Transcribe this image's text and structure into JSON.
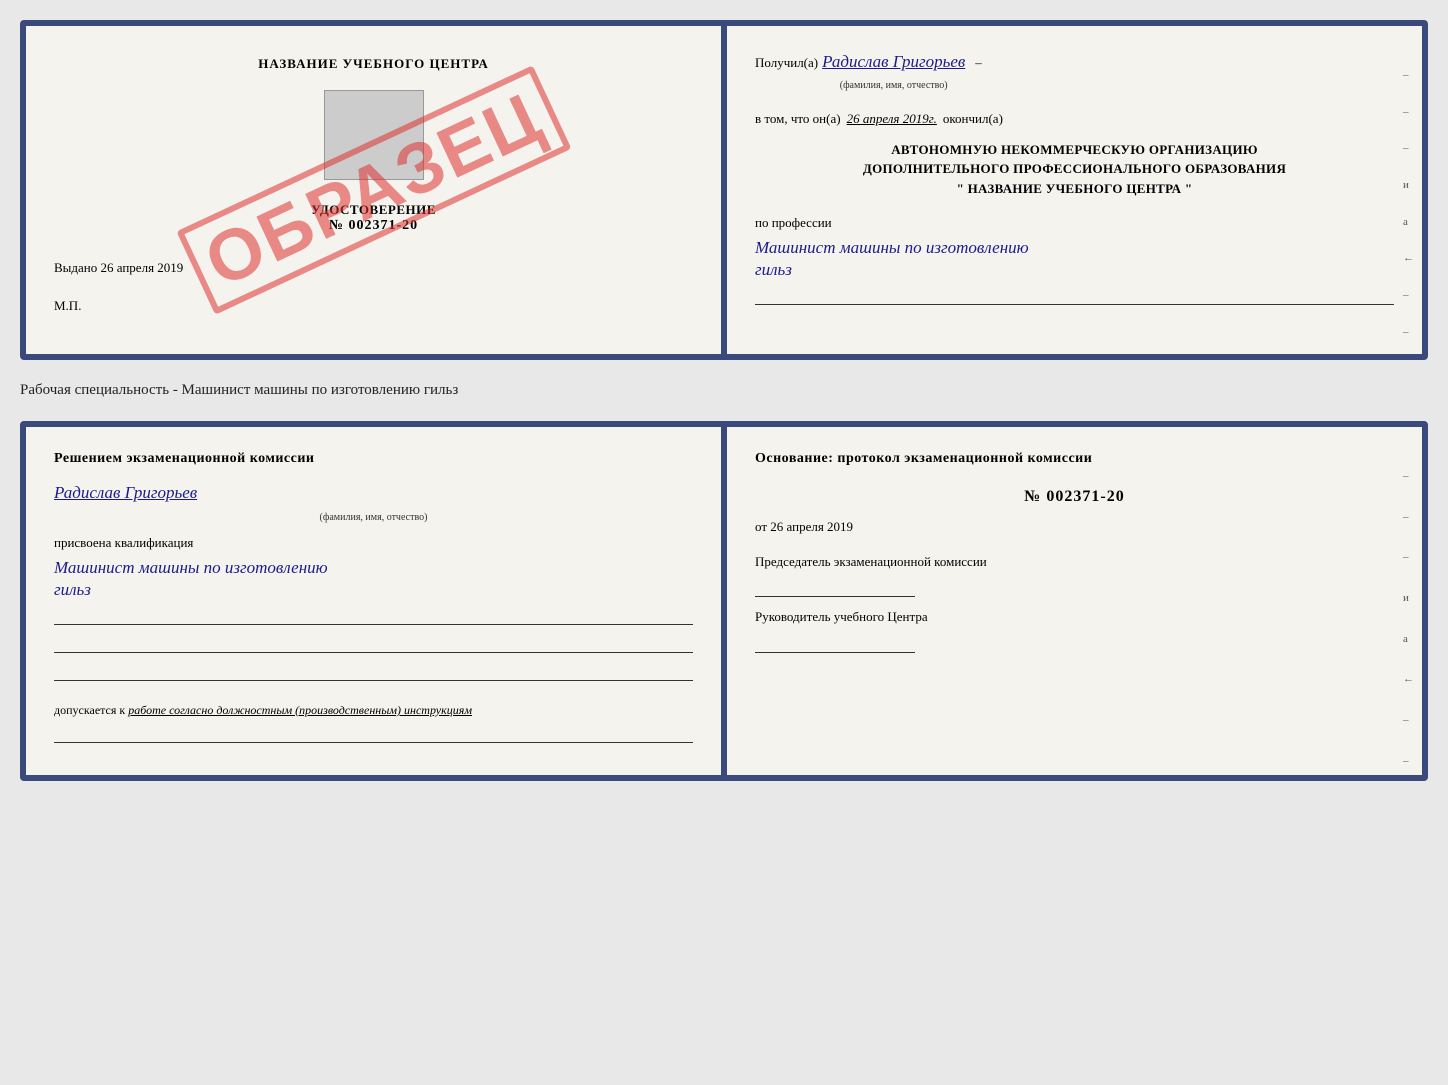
{
  "top_card": {
    "left": {
      "title": "НАЗВАНИЕ УЧЕБНОГО ЦЕНТРА",
      "udostoverenie_label": "УДОСТОВЕРЕНИЕ",
      "number": "№ 002371-20",
      "vydano_label": "Выдано",
      "vydano_date": "26 апреля 2019",
      "mp": "М.П.",
      "stamp": "ОБРАЗЕЦ"
    },
    "right": {
      "poluchil_label": "Получил(а)",
      "poluchil_name": "Радислав Григорьев",
      "fio_subtitle": "(фамилия, имя, отчество)",
      "vtom_label": "в том, что он(а)",
      "vtom_date": "26 апреля 2019г.",
      "okonchil_label": "окончил(а)",
      "org_line1": "АВТОНОМНУЮ НЕКОММЕРЧЕСКУЮ ОРГАНИЗАЦИЮ",
      "org_line2": "ДОПОЛНИТЕЛЬНОГО ПРОФЕССИОНАЛЬНОГО ОБРАЗОВАНИЯ",
      "org_line3": "\"   НАЗВАНИЕ УЧЕБНОГО ЦЕНТРА   \"",
      "po_professii_label": "по профессии",
      "profession_line1": "Машинист машины по изготовлению",
      "profession_line2": "гильз",
      "dashes": [
        "-",
        "-",
        "-",
        "и",
        "а",
        "←",
        "-",
        "-",
        "-"
      ]
    }
  },
  "specialty_label": "Рабочая специальность - Машинист машины по изготовлению гильз",
  "bottom_card": {
    "left": {
      "komissia_title": "Решением экзаменационной комиссии",
      "name": "Радислав Григорьев",
      "fio_subtitle": "(фамилия, имя, отчество)",
      "prisvoena_label": "присвоена квалификация",
      "kvali_line1": "Машинист машины по изготовлению",
      "kvali_line2": "гильз",
      "dopuskaetsya_prefix": "допускается к",
      "dopuskaetsya_text": "работе согласно должностным (производственным) инструкциям"
    },
    "right": {
      "osnovanie_title": "Основание: протокол экзаменационной комиссии",
      "number": "№  002371-20",
      "ot_label": "от",
      "date": "26 апреля 2019",
      "predsedatel_label": "Председатель экзаменационной комиссии",
      "rukovoditel_label": "Руководитель учебного Центра",
      "dashes": [
        "-",
        "-",
        "-",
        "и",
        "а",
        "←",
        "-",
        "-",
        "-"
      ]
    }
  }
}
